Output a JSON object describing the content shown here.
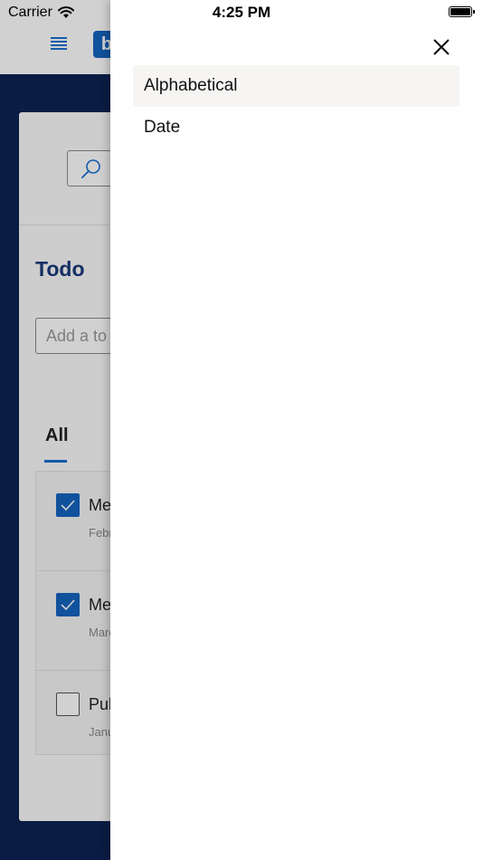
{
  "status_bar": {
    "carrier": "Carrier",
    "time": "4:25 PM"
  },
  "app": {
    "brand_letter": "b",
    "section_title": "Todo",
    "add_placeholder": "Add a to",
    "tab_label": "All",
    "rows": [
      {
        "title": "Me",
        "subtitle": "Febr",
        "checked": true
      },
      {
        "title": "Me",
        "subtitle": "Marc",
        "checked": true
      },
      {
        "title": "Pub",
        "subtitle": "Janu",
        "checked": false
      }
    ]
  },
  "sort_panel": {
    "options": [
      {
        "label": "Alphabetical",
        "selected": true
      },
      {
        "label": "Date",
        "selected": false
      }
    ]
  },
  "colors": {
    "accent": "#1565c0",
    "navy": "#0d2353",
    "selected_bg": "#f6f5f3"
  }
}
